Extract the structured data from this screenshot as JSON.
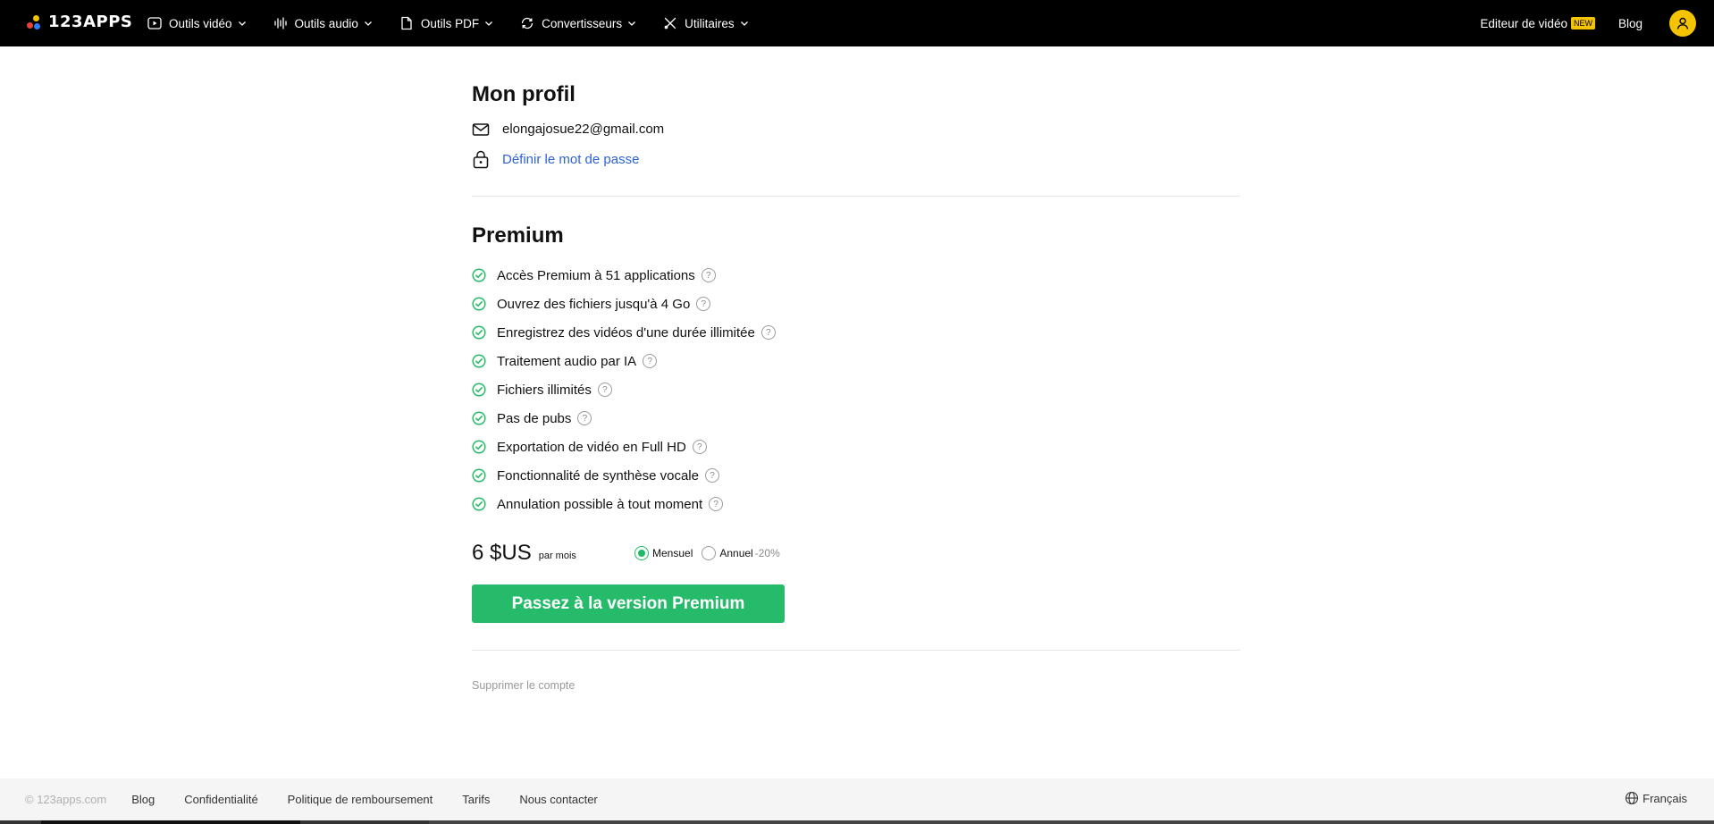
{
  "brand": {
    "logo_text": "123APPS"
  },
  "nav": {
    "items": [
      {
        "label": "Outils vidéo",
        "icon": "play-icon"
      },
      {
        "label": "Outils audio",
        "icon": "waveform-icon"
      },
      {
        "label": "Outils PDF",
        "icon": "document-icon"
      },
      {
        "label": "Convertisseurs",
        "icon": "convert-icon"
      },
      {
        "label": "Utilitaires",
        "icon": "tools-icon"
      }
    ],
    "editor_label": "Editeur de vidéo",
    "editor_badge": "NEW",
    "blog_label": "Blog"
  },
  "profile": {
    "title": "Mon profil",
    "email": "elongajosue22@gmail.com",
    "set_password_label": "Définir le mot de passe"
  },
  "premium": {
    "title": "Premium",
    "features": [
      "Accès Premium à 51 applications",
      "Ouvrez des fichiers jusqu'à 4 Go",
      "Enregistrez des vidéos d'une durée illimitée",
      "Traitement audio par IA",
      "Fichiers illimités",
      "Pas de pubs",
      "Exportation de vidéo en Full HD",
      "Fonctionnalité de synthèse vocale",
      "Annulation possible à tout moment"
    ],
    "help_glyph": "?",
    "price": "6 $US",
    "per_month": "par mois",
    "billing": {
      "monthly_label": "Mensuel",
      "annual_label": "Annuel",
      "annual_discount": "-20%",
      "selected": "Mensuel"
    },
    "cta_label": "Passez à la version Premium"
  },
  "account": {
    "delete_label": "Supprimer le compte"
  },
  "footer": {
    "copyright": "© 123apps.com",
    "links": [
      "Blog",
      "Confidentialité",
      "Politique de remboursement",
      "Tarifs",
      "Nous contacter"
    ],
    "language": "Français"
  },
  "colors": {
    "topbar": "#000000",
    "accent_green": "#26bb6a",
    "link_blue": "#2e63d8",
    "badge_yellow": "#f5c400"
  }
}
